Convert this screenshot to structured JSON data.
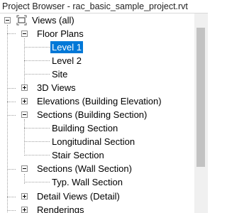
{
  "title": "Project Browser - rac_basic_sample_project.rvt",
  "tree": {
    "root": "Views (all)",
    "floor_plans": "Floor Plans",
    "level1": "Level 1",
    "level2": "Level 2",
    "site": "Site",
    "views3d": "3D Views",
    "elevations": "Elevations (Building Elevation)",
    "sections_building": "Sections (Building Section)",
    "building_section": "Building Section",
    "longitudinal_section": "Longitudinal Section",
    "stair_section": "Stair Section",
    "sections_wall": "Sections (Wall Section)",
    "typ_wall_section": "Typ. Wall Section",
    "detail_views": "Detail Views (Detail)",
    "renderings": "Renderings"
  },
  "colors": {
    "selection": "#0078d7",
    "scroll_thumb": "#c2c2c2"
  },
  "icons": {
    "views": "views-icon",
    "expand": "plus-icon",
    "collapse": "minus-icon"
  }
}
